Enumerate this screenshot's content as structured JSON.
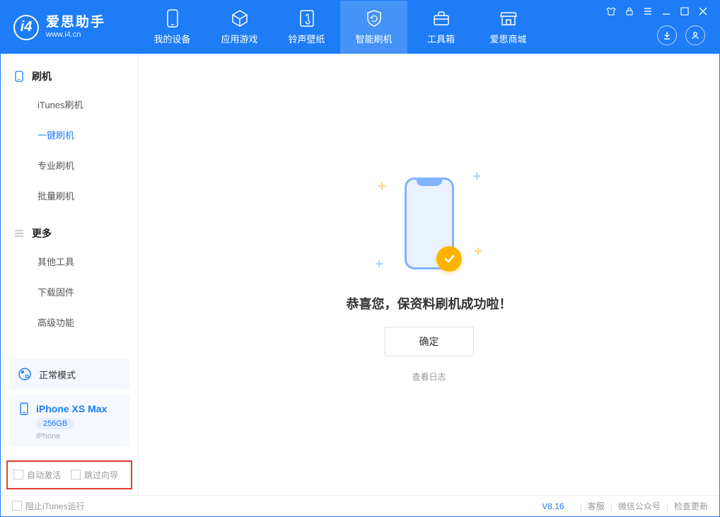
{
  "app": {
    "title": "爱思助手",
    "url": "www.i4.cn"
  },
  "nav": [
    {
      "label": "我的设备"
    },
    {
      "label": "应用游戏"
    },
    {
      "label": "铃声壁纸"
    },
    {
      "label": "智能刷机"
    },
    {
      "label": "工具箱"
    },
    {
      "label": "爱思商城"
    }
  ],
  "sidebar": {
    "section1": {
      "title": "刷机",
      "items": [
        {
          "label": "iTunes刷机"
        },
        {
          "label": "一键刷机"
        },
        {
          "label": "专业刷机"
        },
        {
          "label": "批量刷机"
        }
      ]
    },
    "section2": {
      "title": "更多",
      "items": [
        {
          "label": "其他工具"
        },
        {
          "label": "下载固件"
        },
        {
          "label": "高级功能"
        }
      ]
    }
  },
  "mode": {
    "label": "正常模式"
  },
  "device": {
    "name": "iPhone XS Max",
    "storage": "256GB",
    "type": "iPhone"
  },
  "options": {
    "auto_activate": "自动激活",
    "skip_guide": "跳过向导"
  },
  "main": {
    "message": "恭喜您，保资料刷机成功啦！",
    "ok": "确定",
    "view_log": "查看日志"
  },
  "footer": {
    "block_itunes": "阻止iTunes运行",
    "version": "V8.16",
    "links": [
      "客服",
      "微信公众号",
      "检查更新"
    ]
  }
}
